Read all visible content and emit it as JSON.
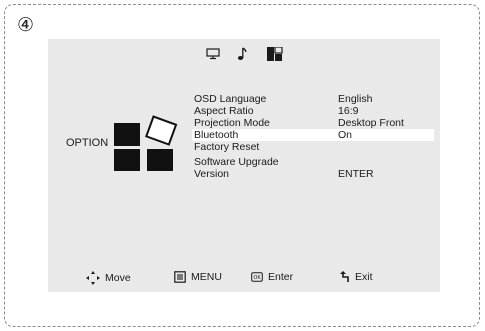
{
  "step_badge": "④",
  "side_label": "OPTION",
  "top_icons": [
    "monitor-icon",
    "music-note-icon",
    "option-tab-icon"
  ],
  "menu": [
    {
      "label": "OSD Language",
      "value": "English",
      "selected": false
    },
    {
      "label": "Aspect Ratio",
      "value": "16:9",
      "selected": false
    },
    {
      "label": "Projection Mode",
      "value": "Desktop Front",
      "selected": false
    },
    {
      "label": "Bluetooth",
      "value": "On",
      "selected": true
    },
    {
      "label": "Factory Reset",
      "value": "",
      "selected": false
    },
    {
      "label": "Software Upgrade\nVersion",
      "value": "ENTER",
      "selected": false
    }
  ],
  "hints": {
    "move": "Move",
    "menu": "MENU",
    "enter": "Enter",
    "exit": "Exit"
  },
  "colors": {
    "panel": "#e9e9e9",
    "selected_row": "#ffffff",
    "icon": "#1a1a1a"
  }
}
